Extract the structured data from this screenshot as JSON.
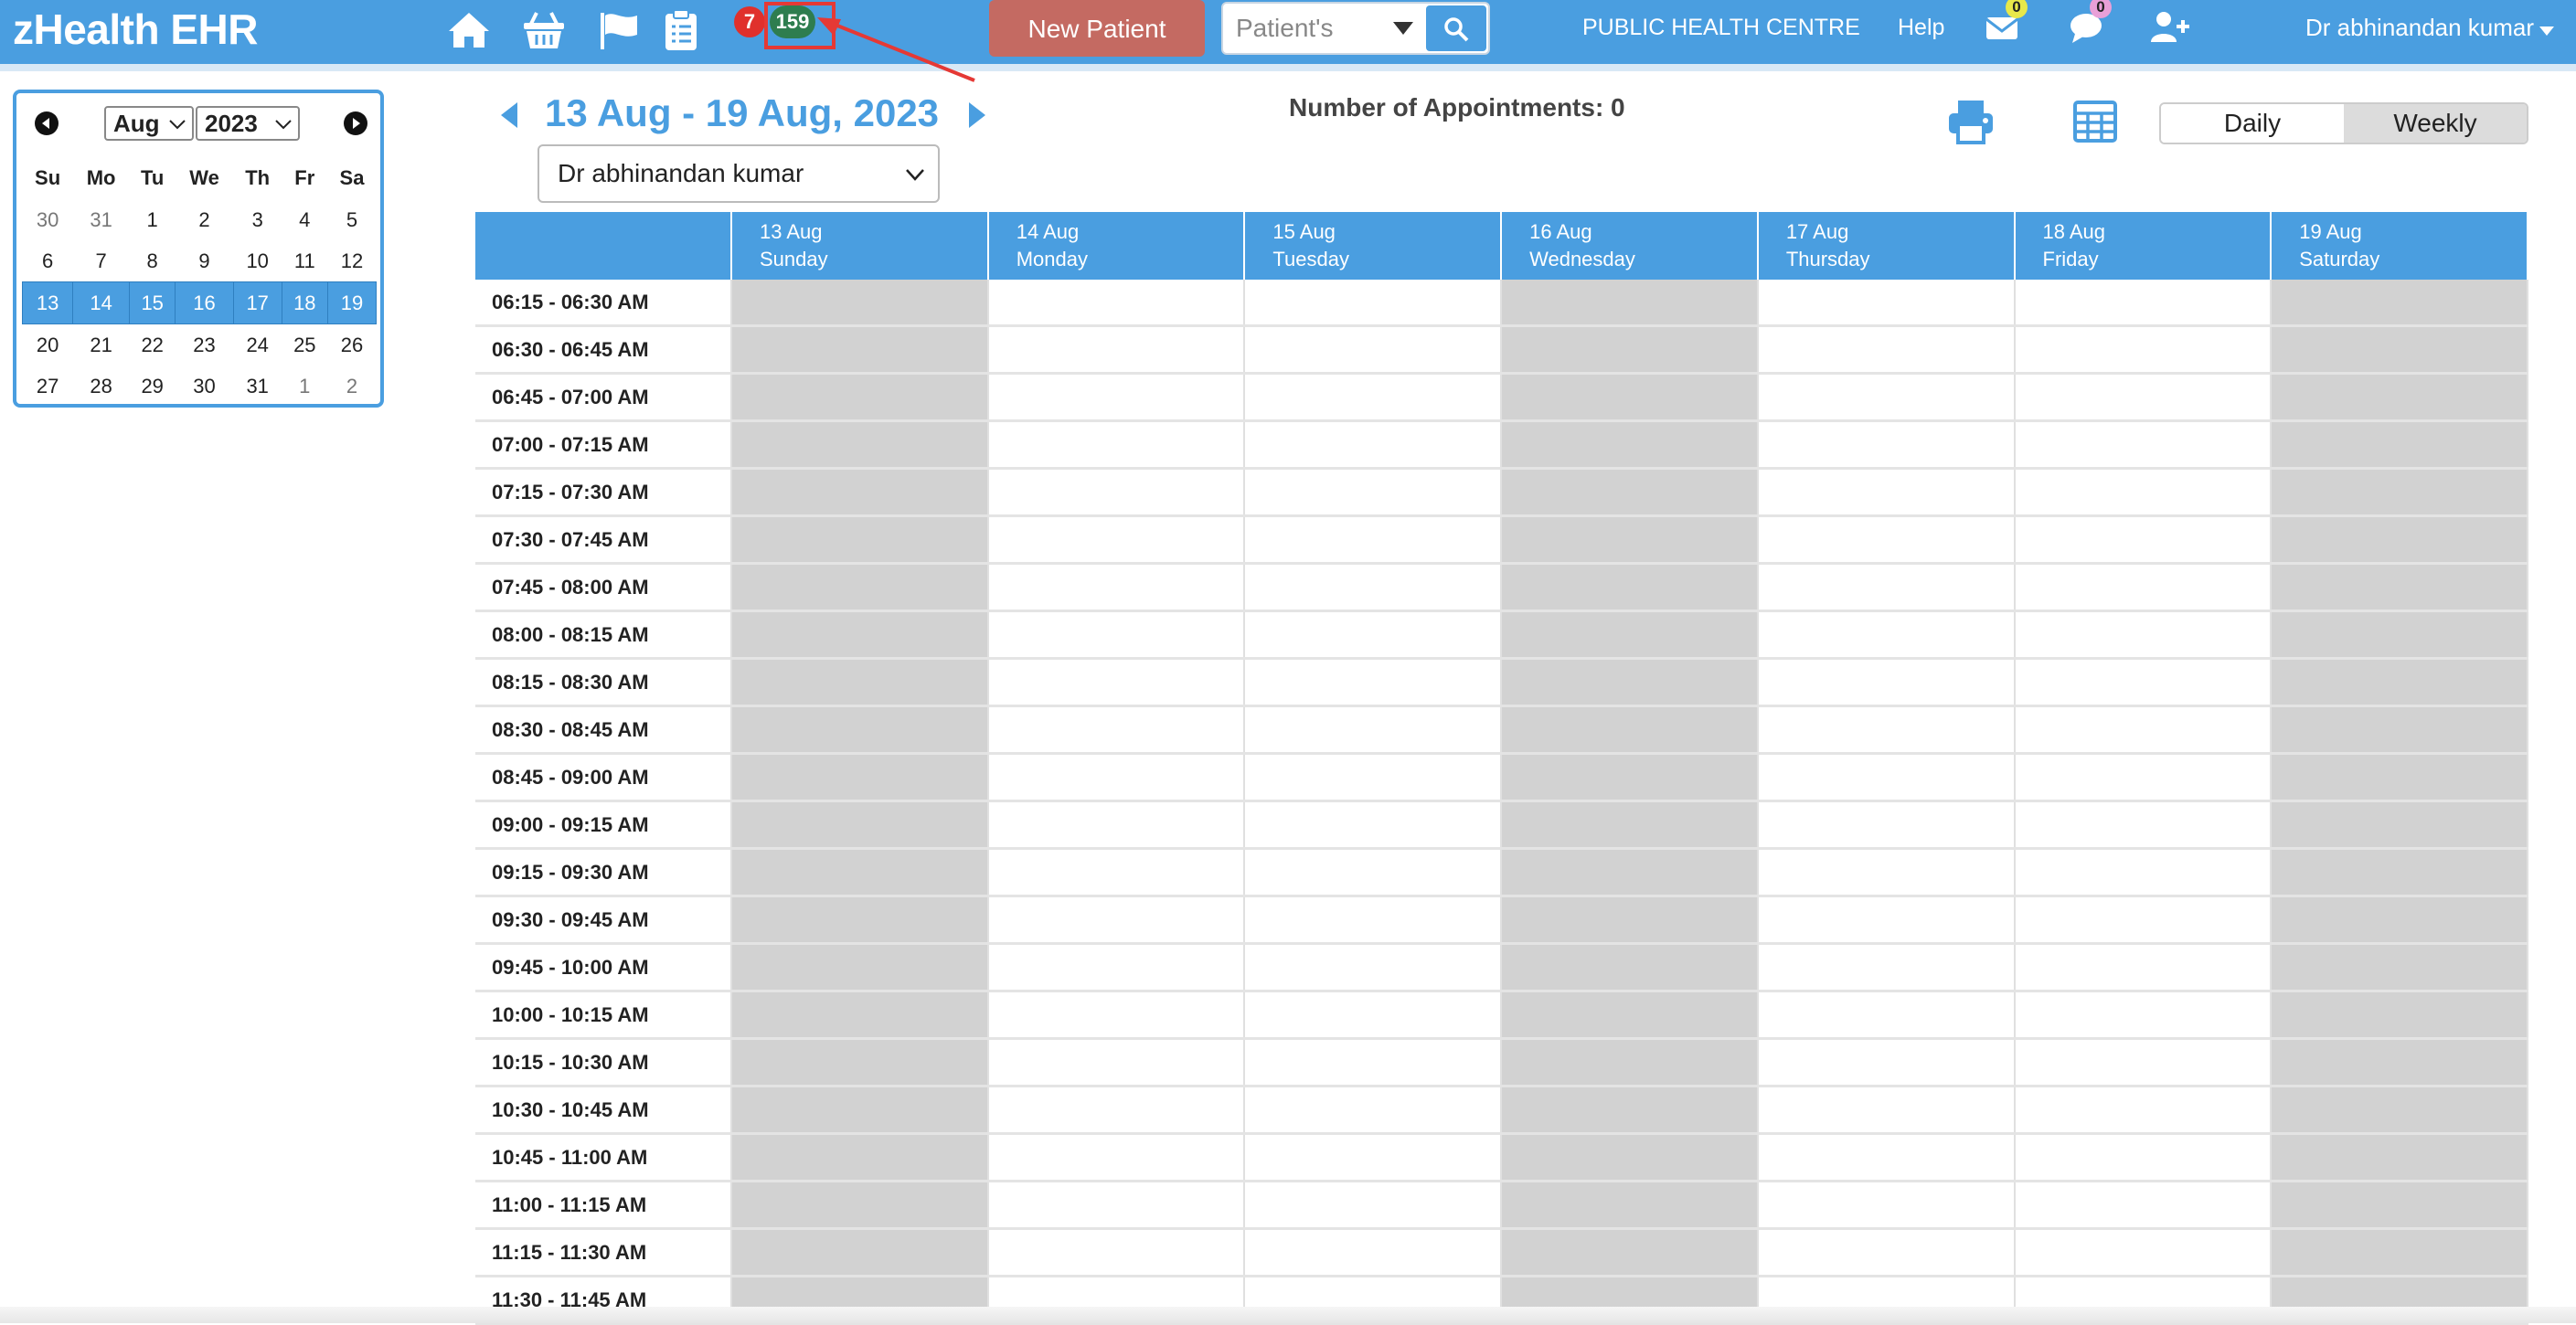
{
  "header": {
    "brand": "zHealth EHR",
    "alert_count": "7",
    "task_count": "159",
    "new_patient_label": "New Patient",
    "search_select": "Patient's",
    "facility": "PUBLIC HEALTH CENTRE",
    "help": "Help",
    "mail_count": "0",
    "chat_count": "0",
    "user_name": "Dr abhinandan kumar",
    "colors": {
      "bar": "#4a9ee0",
      "new_patient": "#c46a62",
      "alert": "#e0302c",
      "task": "#2e7d4f",
      "mail_badge": "#e8e84a",
      "chat_badge": "#e8a0d8"
    }
  },
  "mini_calendar": {
    "month": "Aug",
    "year": "2023",
    "weekdays": [
      "Su",
      "Mo",
      "Tu",
      "We",
      "Th",
      "Fr",
      "Sa"
    ],
    "weeks": [
      [
        {
          "d": "30",
          "m": true
        },
        {
          "d": "31",
          "m": true
        },
        {
          "d": "1"
        },
        {
          "d": "2"
        },
        {
          "d": "3"
        },
        {
          "d": "4"
        },
        {
          "d": "5"
        }
      ],
      [
        {
          "d": "6"
        },
        {
          "d": "7"
        },
        {
          "d": "8"
        },
        {
          "d": "9"
        },
        {
          "d": "10"
        },
        {
          "d": "11"
        },
        {
          "d": "12"
        }
      ],
      [
        {
          "d": "13",
          "s": true
        },
        {
          "d": "14",
          "s": true
        },
        {
          "d": "15",
          "s": true
        },
        {
          "d": "16",
          "s": true
        },
        {
          "d": "17",
          "s": true
        },
        {
          "d": "18",
          "s": true
        },
        {
          "d": "19",
          "s": true
        }
      ],
      [
        {
          "d": "20"
        },
        {
          "d": "21"
        },
        {
          "d": "22"
        },
        {
          "d": "23"
        },
        {
          "d": "24"
        },
        {
          "d": "25"
        },
        {
          "d": "26"
        }
      ],
      [
        {
          "d": "27"
        },
        {
          "d": "28"
        },
        {
          "d": "29"
        },
        {
          "d": "30"
        },
        {
          "d": "31"
        },
        {
          "d": "1",
          "m": true
        },
        {
          "d": "2",
          "m": true
        }
      ]
    ]
  },
  "schedule": {
    "week_title": "13 Aug - 19 Aug, 2023",
    "appointments_label": "Number of Appointments: 0",
    "doctor": "Dr abhinandan kumar",
    "view_daily": "Daily",
    "view_weekly": "Weekly",
    "days": [
      {
        "date": "13 Aug",
        "name": "Sunday",
        "off": true
      },
      {
        "date": "14 Aug",
        "name": "Monday",
        "off": false
      },
      {
        "date": "15 Aug",
        "name": "Tuesday",
        "off": false
      },
      {
        "date": "16 Aug",
        "name": "Wednesday",
        "off": true
      },
      {
        "date": "17 Aug",
        "name": "Thursday",
        "off": false
      },
      {
        "date": "18 Aug",
        "name": "Friday",
        "off": false
      },
      {
        "date": "19 Aug",
        "name": "Saturday",
        "off": true
      }
    ],
    "slots": [
      "06:15 - 06:30 AM",
      "06:30 - 06:45 AM",
      "06:45 - 07:00 AM",
      "07:00 - 07:15 AM",
      "07:15 - 07:30 AM",
      "07:30 - 07:45 AM",
      "07:45 - 08:00 AM",
      "08:00 - 08:15 AM",
      "08:15 - 08:30 AM",
      "08:30 - 08:45 AM",
      "08:45 - 09:00 AM",
      "09:00 - 09:15 AM",
      "09:15 - 09:30 AM",
      "09:30 - 09:45 AM",
      "09:45 - 10:00 AM",
      "10:00 - 10:15 AM",
      "10:15 - 10:30 AM",
      "10:30 - 10:45 AM",
      "10:45 - 11:00 AM",
      "11:00 - 11:15 AM",
      "11:15 - 11:30 AM",
      "11:30 - 11:45 AM"
    ]
  }
}
